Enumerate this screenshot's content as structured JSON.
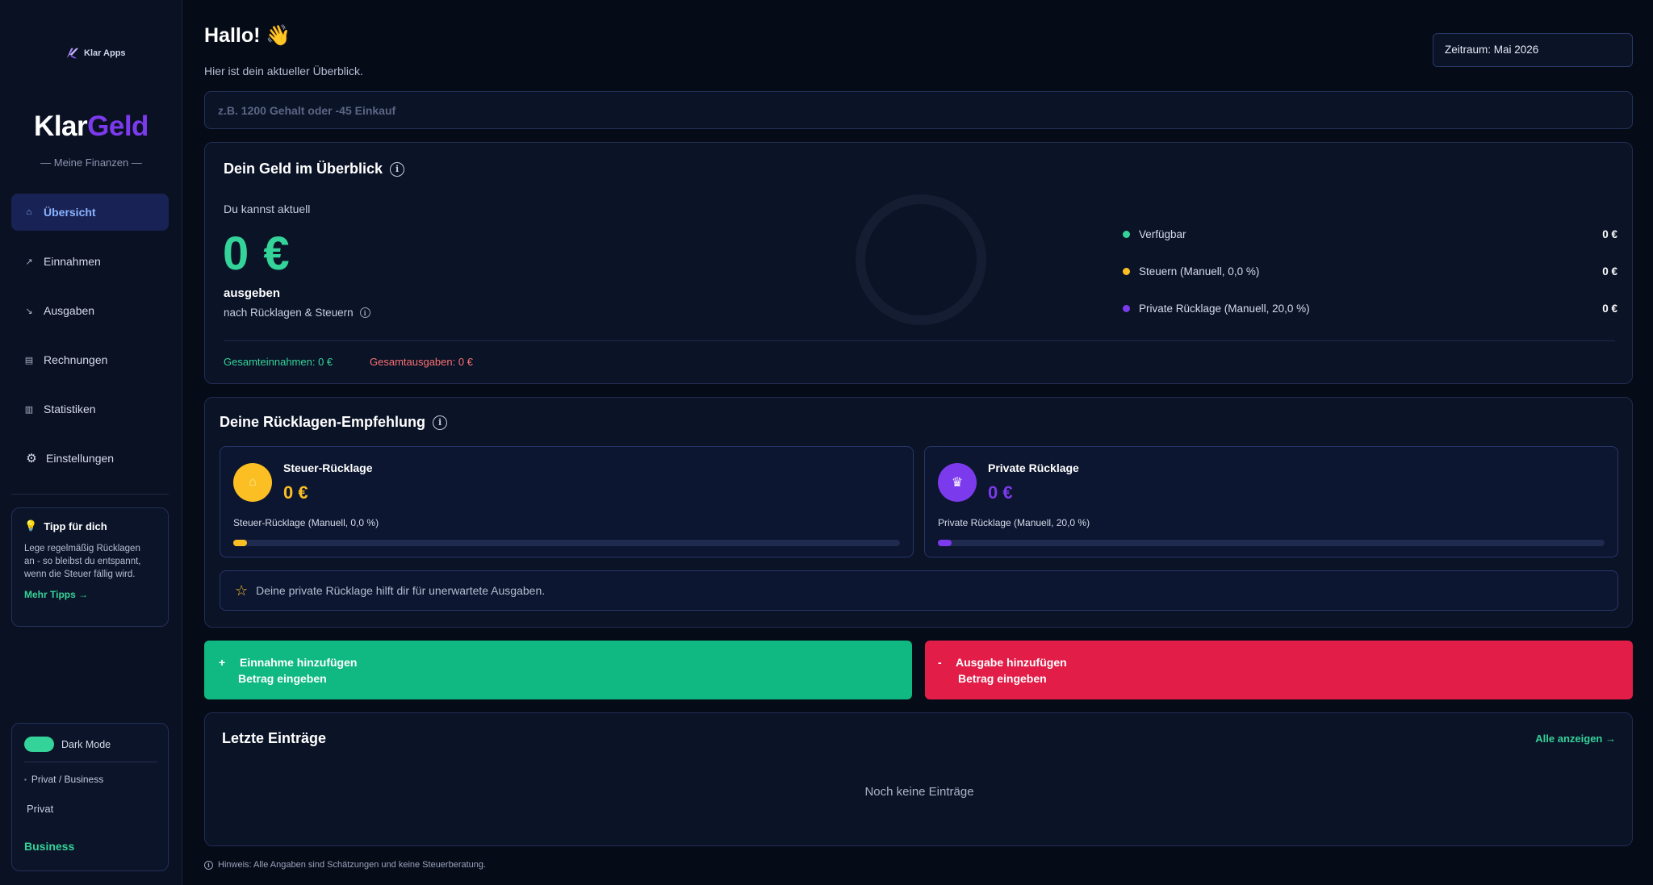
{
  "sidebar": {
    "brand_small": "Klar Apps",
    "brand_big_part1": "Klar",
    "brand_big_part2": "Geld",
    "brand_subtitle": "— Meine Finanzen —",
    "nav": [
      {
        "label": "Übersicht",
        "icon": "home-icon"
      },
      {
        "label": "Einnahmen",
        "icon": "trend-up-icon"
      },
      {
        "label": "Ausgaben",
        "icon": "trend-down-icon"
      },
      {
        "label": "Rechnungen",
        "icon": "invoice-icon"
      },
      {
        "label": "Statistiken",
        "icon": "chart-icon"
      },
      {
        "label": "Einstellungen",
        "icon": "gear-icon"
      }
    ],
    "tip": {
      "title": "Tipp für dich",
      "text": "Lege regelmäßig Rücklagen an - so bleibst du entspannt, wenn die Steuer fällig wird.",
      "link": "Mehr Tipps →"
    },
    "settings": {
      "dark_mode_label": "Dark Mode",
      "mode_label": "Privat / Business",
      "option_privat": "Privat",
      "option_business": "Business"
    }
  },
  "header": {
    "greeting": "Hallo! 👋",
    "subtitle": "Hier ist dein aktueller Überblick.",
    "period": "Zeitraum: Mai 2026"
  },
  "quick_input": {
    "placeholder": "z.B. 1200 Gehalt oder -45 Einkauf",
    "value": ""
  },
  "overview": {
    "title": "Dein Geld im Überblick",
    "can_label": "Du kannst aktuell",
    "amount": "0 €",
    "spend_label": "ausgeben",
    "after_label": "nach Rücklagen & Steuern",
    "legend": [
      {
        "label": "Verfügbar",
        "value": "0 €",
        "color": "#34d399"
      },
      {
        "label": "Steuern (Manuell, 0,0 %)",
        "value": "0 €",
        "color": "#fbbf24"
      },
      {
        "label": "Private Rücklage (Manuell, 20,0 %)",
        "value": "0 €",
        "color": "#7c3aed"
      }
    ],
    "total_income": "Gesamteinnahmen: 0 €",
    "total_expense": "Gesamtausgaben: 0 €"
  },
  "reserve": {
    "title": "Deine Rücklagen-Empfehlung",
    "tax": {
      "name": "Steuer-Rücklage",
      "amount": "0 €",
      "desc": "Steuer-Rücklage (Manuell, 0,0 %)",
      "icon": "money-bag-icon",
      "color": "#fbbf24",
      "progress": 0
    },
    "private": {
      "name": "Private Rücklage",
      "amount": "0 €",
      "desc": "Private Rücklage (Manuell, 20,0 %)",
      "icon": "piggy-bank-icon",
      "color": "#7c3aed",
      "progress": 0
    },
    "hint": "Deine private Rücklage hilft dir für unerwartete Ausgaben."
  },
  "actions": {
    "income_symbol": "+",
    "income_label": "Einnahme hinzufügen",
    "income_sub": "Betrag eingeben",
    "expense_symbol": "-",
    "expense_label": "Ausgabe hinzufügen",
    "expense_sub": "Betrag eingeben"
  },
  "recent": {
    "title": "Letzte Einträge",
    "show_all": "Alle anzeigen →",
    "empty": "Noch keine Einträge"
  },
  "footer": "Hinweis: Alle Angaben sind Schätzungen und keine Steuerberatung."
}
